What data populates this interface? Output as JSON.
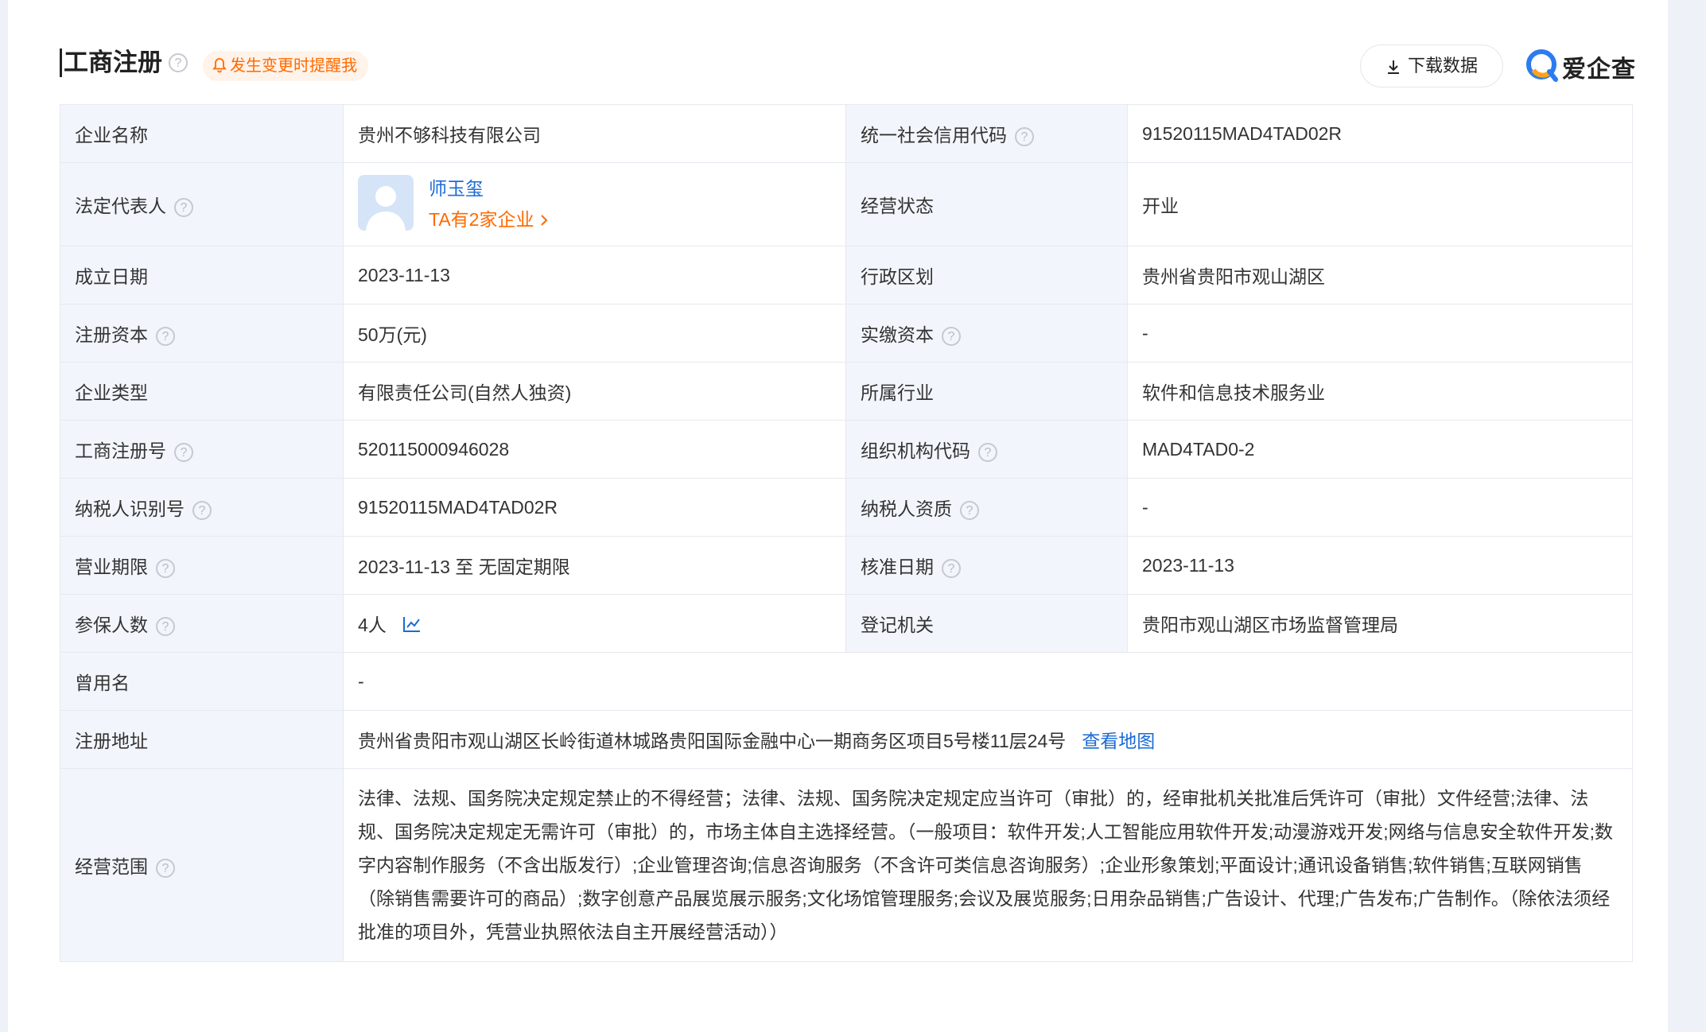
{
  "header": {
    "title": "工商注册",
    "remind_label": "发生变更时提醒我",
    "download_label": "下载数据",
    "logo_text": "爱企查"
  },
  "help_icon_glyph": "?",
  "rows": {
    "company_name_label": "企业名称",
    "company_name": "贵州不够科技有限公司",
    "credit_code_label": "统一社会信用代码",
    "credit_code": "91520115MAD4TAD02R",
    "legal_rep_label": "法定代表人",
    "legal_rep_name": "师玉玺",
    "legal_rep_companies": "TA有2家企业",
    "status_label": "经营状态",
    "status": "开业",
    "found_date_label": "成立日期",
    "found_date": "2023-11-13",
    "region_label": "行政区划",
    "region": "贵州省贵阳市观山湖区",
    "reg_capital_label": "注册资本",
    "reg_capital": "50万(元)",
    "paid_capital_label": "实缴资本",
    "paid_capital": "-",
    "company_type_label": "企业类型",
    "company_type": "有限责任公司(自然人独资)",
    "industry_label": "所属行业",
    "industry": "软件和信息技术服务业",
    "reg_no_label": "工商注册号",
    "reg_no": "520115000946028",
    "org_code_label": "组织机构代码",
    "org_code": "MAD4TAD0-2",
    "taxpayer_id_label": "纳税人识别号",
    "taxpayer_id": "91520115MAD4TAD02R",
    "taxpayer_qual_label": "纳税人资质",
    "taxpayer_qual": "-",
    "term_label": "营业期限",
    "term": "2023-11-13 至 无固定期限",
    "approve_date_label": "核准日期",
    "approve_date": "2023-11-13",
    "insured_label": "参保人数",
    "insured": "4人",
    "authority_label": "登记机关",
    "authority": "贵阳市观山湖区市场监督管理局",
    "former_name_label": "曾用名",
    "former_name": "-",
    "address_label": "注册地址",
    "address": "贵州省贵阳市观山湖区长岭街道林城路贵阳国际金融中心一期商务区项目5号楼11层24号",
    "map_link": "查看地图",
    "scope_label": "经营范围",
    "scope": "法律、法规、国务院决定规定禁止的不得经营；法律、法规、国务院决定规定应当许可（审批）的，经审批机关批准后凭许可（审批）文件经营;法律、法规、国务院决定规定无需许可（审批）的，市场主体自主选择经营。（一般项目：软件开发;人工智能应用软件开发;动漫游戏开发;网络与信息安全软件开发;数字内容制作服务（不含出版发行）;企业管理咨询;信息咨询服务（不含许可类信息咨询服务）;企业形象策划;平面设计;通讯设备销售;软件销售;互联网销售（除销售需要许可的商品）;数字创意产品展览展示服务;文化场馆管理服务;会议及展览服务;日用杂品销售;广告设计、代理;广告发布;广告制作。（除依法须经批准的项目外，凭营业执照依法自主开展经营活动））"
  },
  "colors": {
    "label_bg": "#f2f6fc",
    "border": "#e6e9ee",
    "link": "#1a6bd6",
    "accent_orange": "#ff6a00"
  }
}
